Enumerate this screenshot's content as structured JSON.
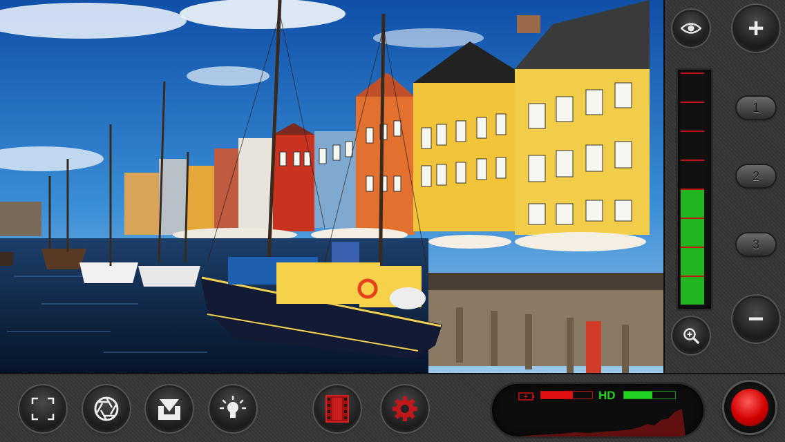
{
  "viewfinder": {
    "scene": "harbor-canal-with-sailboats-and-colorful-buildings"
  },
  "right_panel": {
    "preview_icon": "eye-icon",
    "zoom_in_label": "+",
    "zoom_out_label": "−",
    "presets": [
      "1",
      "2",
      "3"
    ],
    "zoom_icon": "magnifier-plus-icon",
    "audio_meter": {
      "total_segments": 8,
      "active_segments": 4,
      "level": 0.5,
      "active_color": "#21b521",
      "marker_color": "#c41414"
    }
  },
  "bottom_bar": {
    "buttons": [
      {
        "name": "frame-guides",
        "icon": "frame-corners-icon"
      },
      {
        "name": "aperture",
        "icon": "aperture-icon"
      },
      {
        "name": "save-to-roll",
        "icon": "download-icon"
      },
      {
        "name": "light",
        "icon": "light-bulb-icon"
      },
      {
        "name": "film-library",
        "icon": "film-strip-icon"
      },
      {
        "name": "settings",
        "icon": "gear-icon"
      }
    ],
    "status": {
      "battery_icon": "battery-icon",
      "battery_level": 0.62,
      "hd_label": "HD",
      "storage_level": 0.55,
      "battery_color": "#e01010",
      "hd_color": "#21d321"
    },
    "record_button": {
      "icon": "record-icon",
      "color": "#d00000"
    }
  }
}
